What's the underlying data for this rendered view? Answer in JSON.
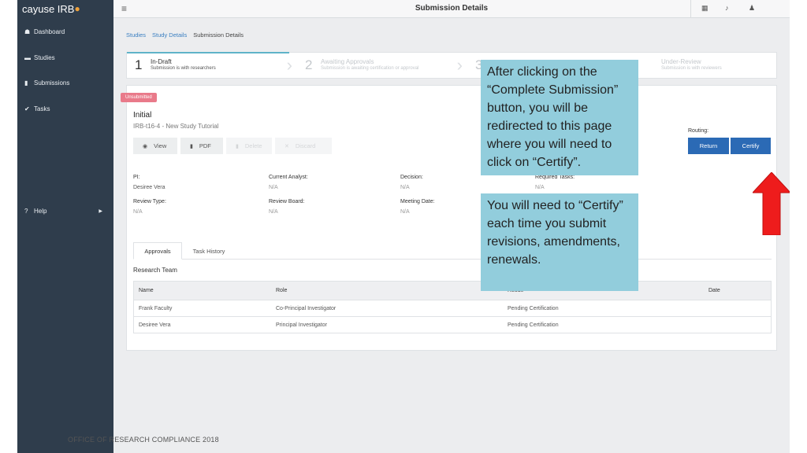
{
  "app": {
    "brand": "cayuse IRB",
    "brand_mark": "●",
    "page_title": "Submission Details"
  },
  "sidebar": {
    "items": [
      {
        "label": "Dashboard",
        "icon": "home-icon",
        "glyph": "☗"
      },
      {
        "label": "Studies",
        "icon": "folder-icon",
        "glyph": "▬"
      },
      {
        "label": "Submissions",
        "icon": "document-icon",
        "glyph": "▮"
      },
      {
        "label": "Tasks",
        "icon": "check-icon",
        "glyph": "✔"
      },
      {
        "label": "Help",
        "icon": "help-icon",
        "glyph": "?",
        "caret": "▶"
      }
    ]
  },
  "header": {
    "menu_icon": "≡",
    "grid_icon": "▦",
    "bell_icon": "♪",
    "user_icon": "♟"
  },
  "breadcrumb": {
    "studies": "Studies",
    "study_details": "Study Details",
    "current": "Submission Details"
  },
  "stepper": {
    "steps": [
      {
        "num": "1",
        "title": "In-Draft",
        "sub": "Submission is with researchers"
      },
      {
        "num": "2",
        "title": "Awaiting Approvals",
        "sub": "Submission is awaiting certification or approval"
      },
      {
        "num": "3",
        "title": "",
        "sub": ""
      },
      {
        "num": "",
        "title": "Under-Review",
        "sub": "Submission is with reviewers"
      }
    ]
  },
  "submission": {
    "badge": "Unsubmitted",
    "title": "Initial",
    "id": "IRB-t16-4 - New Study Tutorial",
    "actions": [
      {
        "label": "View",
        "glyph": "◉",
        "icon": "eye-icon"
      },
      {
        "label": "PDF",
        "glyph": "▮",
        "icon": "pdf-icon"
      },
      {
        "label": "Delete",
        "glyph": "▮",
        "icon": "trash-icon"
      },
      {
        "label": "Discard",
        "glyph": "✕",
        "icon": "discard-icon"
      }
    ],
    "routing_label": "Routing:",
    "return_label": "Return",
    "certify_label": "Certify"
  },
  "info": {
    "pi_label": "PI:",
    "pi_value": "Desiree Vera",
    "analyst_label": "Current Analyst:",
    "analyst_value": "N/A",
    "decision_label": "Decision:",
    "decision_value": "N/A",
    "tasks_label": "Required Tasks:",
    "tasks_value": "N/A",
    "review_type_label": "Review Type:",
    "review_type_value": "N/A",
    "board_label": "Review Board:",
    "board_value": "N/A",
    "meeting_label": "Meeting Date:",
    "meeting_value": "N/A"
  },
  "tabs": {
    "approvals": "Approvals",
    "task_history": "Task History"
  },
  "team": {
    "heading": "Research Team",
    "columns": {
      "name": "Name",
      "role": "Role",
      "result": "Result",
      "date": "Date"
    },
    "rows": [
      {
        "name": "Frank Faculty",
        "role": "Co-Principal Investigator",
        "result": "Pending Certification",
        "date": ""
      },
      {
        "name": "Desiree Vera",
        "role": "Principal Investigator",
        "result": "Pending Certification",
        "date": ""
      }
    ]
  },
  "callouts": {
    "top": "After clicking on the “Complete Submission” button, you will be redirected to this page where you will need to click on “Certify”.",
    "bottom": "You will need to “Certify” each time you submit revisions, amendments, renewals."
  },
  "footer": "OFFICE OF RESEARCH COMPLIANCE 2018",
  "colors": {
    "sidebar": "#2f3d4c",
    "accent": "#2b6ab5",
    "callout": "#92cddc",
    "arrow": "#ee1c1c",
    "badge": "#e97a8a"
  }
}
